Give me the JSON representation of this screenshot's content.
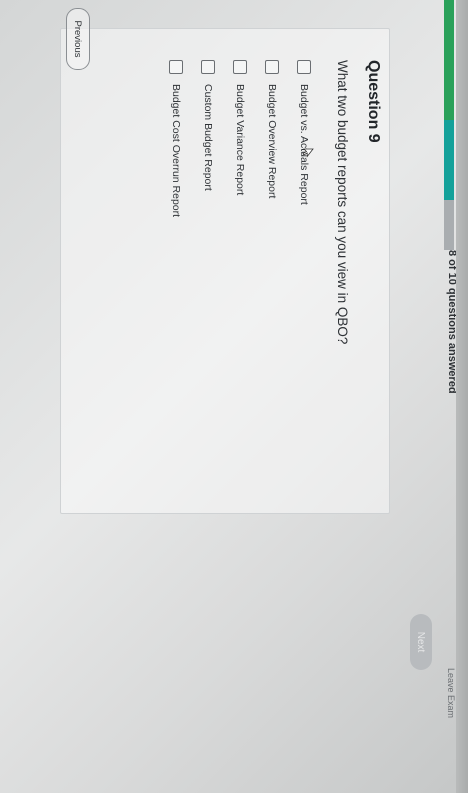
{
  "progress": {
    "text": "8 of 10 questions answered",
    "answered": 8,
    "total": 10,
    "fraction": 0.8
  },
  "header": {
    "leave_exam_label": "Leave Exam"
  },
  "question": {
    "title": "Question 9",
    "text": "What two budget reports can you view in QBO?",
    "options": [
      {
        "label": "Budget vs. Actuals Report",
        "checked": false
      },
      {
        "label": "Budget Overview Report",
        "checked": false
      },
      {
        "label": "Budget Variance Report",
        "checked": false
      },
      {
        "label": "Custom Budget Report",
        "checked": false
      },
      {
        "label": "Budget Cost Overrun Report",
        "checked": false
      }
    ]
  },
  "footer": {
    "next_label": "Next",
    "previous_label": "Previous"
  },
  "colors": {
    "progress_green": "#2aa15a",
    "progress_teal": "#14a19a",
    "progress_track": "#a9adb0",
    "next_disabled": "#b8bbbe"
  }
}
